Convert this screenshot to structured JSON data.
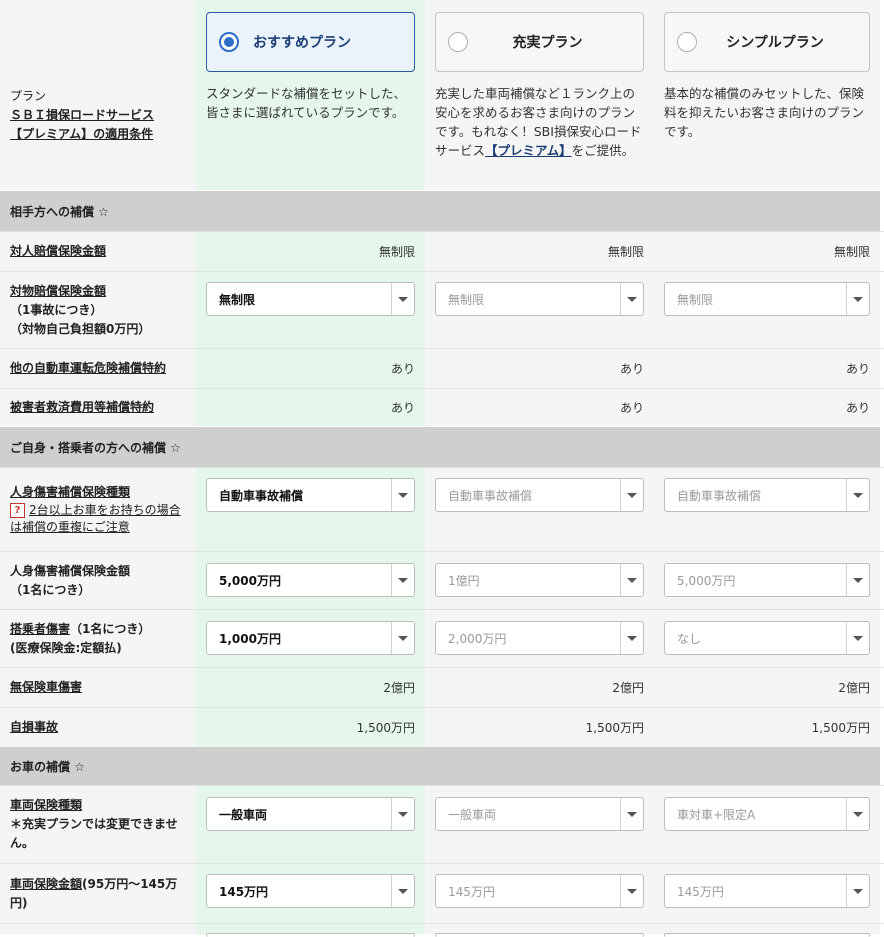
{
  "header": {
    "label_line1": "プラン",
    "label_line2": "ＳＢＩ損保ロードサービス",
    "label_line3": "【プレミアム】の適用条件",
    "plans": [
      {
        "name": "おすすめプラン",
        "selected": true,
        "desc": "スタンダードな補償をセットした、皆さまに選ばれているプランです。"
      },
      {
        "name": "充実プラン",
        "selected": false,
        "desc_pre": "充実した車両補償など１ランク上の安心を求めるお客さま向けのプランです。もれなく！SBI損保安心ロードサービス",
        "desc_link": "【プレミアム】",
        "desc_post": "をご提供。"
      },
      {
        "name": "シンプルプラン",
        "selected": false,
        "desc": "基本的な補償のみセットした、保険料を抑えたいお客さま向けのプランです。"
      }
    ]
  },
  "sections": {
    "opponent": "相手方への補償 ☆",
    "self": "ご自身・搭乗者の方への補償 ☆",
    "car": "お車の補償 ☆"
  },
  "rows": {
    "bodily": {
      "label": "対人賠償保険金額",
      "values": [
        "無制限",
        "無制限",
        "無制限"
      ]
    },
    "property": {
      "label": "対物賠償保険金額",
      "sub1": "（1事故につき）",
      "sub2": "（対物自己負担額0万円）",
      "values": [
        "無制限",
        "無制限",
        "無制限"
      ]
    },
    "other_car": {
      "label": "他の自動車運転危険補償特約",
      "values": [
        "あり",
        "あり",
        "あり"
      ]
    },
    "victim": {
      "label": "被害者救済費用等補償特約",
      "values": [
        "あり",
        "あり",
        "あり"
      ]
    },
    "injury_type": {
      "label": "人身傷害補償保険種類",
      "hint_icon": "?",
      "hint": "2台以上お車をお持ちの場合は補償の重複にご注意",
      "values": [
        "自動車事故補償",
        "自動車事故補償",
        "自動車事故補償"
      ]
    },
    "injury_amount": {
      "label": "人身傷害補償保険金額",
      "sub1": "（1名につき）",
      "values": [
        "5,000万円",
        "1億円",
        "5,000万円"
      ]
    },
    "passenger": {
      "label": "搭乗者傷害",
      "label_suffix": "（1名につき）",
      "sub1": "(医療保険金:定額払)",
      "values": [
        "1,000万円",
        "2,000万円",
        "なし"
      ]
    },
    "uninsured": {
      "label": "無保険車傷害",
      "values": [
        "2億円",
        "2億円",
        "2億円"
      ]
    },
    "self_accident": {
      "label": "自損事故",
      "values": [
        "1,500万円",
        "1,500万円",
        "1,500万円"
      ]
    },
    "vehicle_type": {
      "label": "車両保険種類",
      "sub1": "＊充実プランでは変更できません。",
      "values": [
        "一般車両",
        "一般車両",
        "車対車+限定A"
      ]
    },
    "vehicle_amount": {
      "label": "車両保険金額",
      "label_suffix": "(95万円〜145万円)",
      "values": [
        "145万円",
        "145万円",
        "145万円"
      ]
    }
  },
  "icons": {
    "dropdown": "chevron-down-icon",
    "radio": "radio-icon",
    "help": "help-icon"
  },
  "colors": {
    "recommended_bg": "#e5f7ea",
    "section_bg": "#cfcfcf",
    "selected_border": "#2a5aa0"
  }
}
